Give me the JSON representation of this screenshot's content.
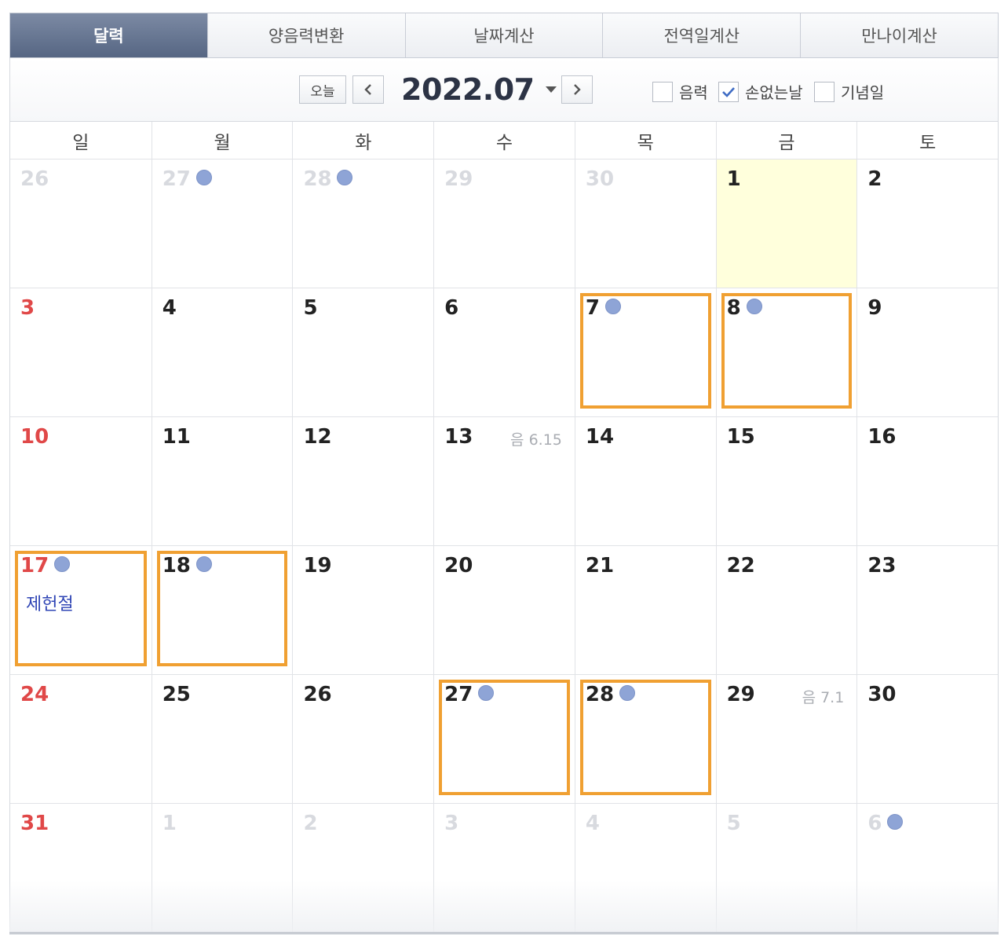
{
  "tabs": [
    "달력",
    "양음력변환",
    "날짜계산",
    "전역일계산",
    "만나이계산"
  ],
  "toolbar": {
    "today_label": "오늘",
    "month_label": "2022.07",
    "prev_icon": "chevron-left-icon",
    "next_icon": "chevron-right-icon",
    "options": [
      {
        "label": "음력",
        "checked": false
      },
      {
        "label": "손없는날",
        "checked": true
      },
      {
        "label": "기념일",
        "checked": false
      }
    ]
  },
  "weekdays": [
    "일",
    "월",
    "화",
    "수",
    "목",
    "금",
    "토"
  ],
  "colors": {
    "active_tab": "#5f6e8a",
    "sunday": "#e04848",
    "dot": "#8ea4d6",
    "today_bg": "#ffffdc",
    "highlight": "#f0a032",
    "holiday": "#2f45b5"
  },
  "weeks": [
    [
      {
        "day": "26",
        "other": true,
        "dot": false
      },
      {
        "day": "27",
        "other": true,
        "dot": true
      },
      {
        "day": "28",
        "other": true,
        "dot": true
      },
      {
        "day": "29",
        "other": true,
        "dot": false
      },
      {
        "day": "30",
        "other": true,
        "dot": false
      },
      {
        "day": "1",
        "today": true
      },
      {
        "day": "2"
      }
    ],
    [
      {
        "day": "3"
      },
      {
        "day": "4"
      },
      {
        "day": "5"
      },
      {
        "day": "6"
      },
      {
        "day": "7",
        "dot": true,
        "highlight": true
      },
      {
        "day": "8",
        "dot": true,
        "highlight": true
      },
      {
        "day": "9"
      }
    ],
    [
      {
        "day": "10"
      },
      {
        "day": "11"
      },
      {
        "day": "12"
      },
      {
        "day": "13",
        "lunar": "음 6.15"
      },
      {
        "day": "14"
      },
      {
        "day": "15"
      },
      {
        "day": "16"
      }
    ],
    [
      {
        "day": "17",
        "dot": true,
        "highlight": true,
        "holiday": "제헌절"
      },
      {
        "day": "18",
        "dot": true,
        "highlight": true
      },
      {
        "day": "19"
      },
      {
        "day": "20"
      },
      {
        "day": "21"
      },
      {
        "day": "22"
      },
      {
        "day": "23"
      }
    ],
    [
      {
        "day": "24"
      },
      {
        "day": "25"
      },
      {
        "day": "26"
      },
      {
        "day": "27",
        "dot": true,
        "highlight": true
      },
      {
        "day": "28",
        "dot": true,
        "highlight": true
      },
      {
        "day": "29",
        "lunar": "음 7.1"
      },
      {
        "day": "30"
      }
    ],
    [
      {
        "day": "31"
      },
      {
        "day": "1",
        "other": true
      },
      {
        "day": "2",
        "other": true
      },
      {
        "day": "3",
        "other": true
      },
      {
        "day": "4",
        "other": true
      },
      {
        "day": "5",
        "other": true
      },
      {
        "day": "6",
        "other": true,
        "dot": true
      }
    ]
  ]
}
